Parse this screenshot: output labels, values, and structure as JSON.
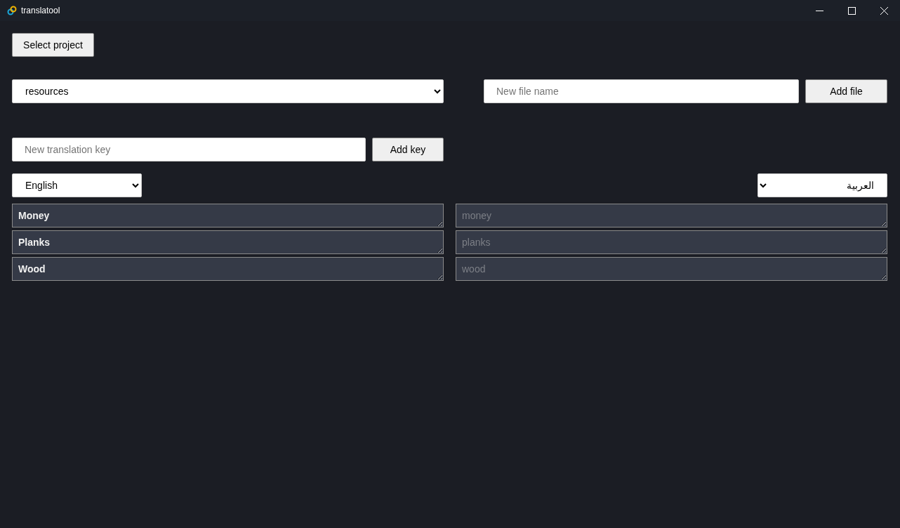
{
  "window": {
    "title": "translatool"
  },
  "select_project_button": "Select project",
  "file_select": {
    "value": "resources"
  },
  "new_file": {
    "placeholder": "New file name",
    "button": "Add file"
  },
  "new_key": {
    "placeholder": "New translation key",
    "button": "Add key"
  },
  "source_language": {
    "value": "English"
  },
  "target_language": {
    "value": "العربية"
  },
  "rows": [
    {
      "source": "Money",
      "target_placeholder": "money"
    },
    {
      "source": "Planks",
      "target_placeholder": "planks"
    },
    {
      "source": "Wood",
      "target_placeholder": "wood"
    }
  ]
}
